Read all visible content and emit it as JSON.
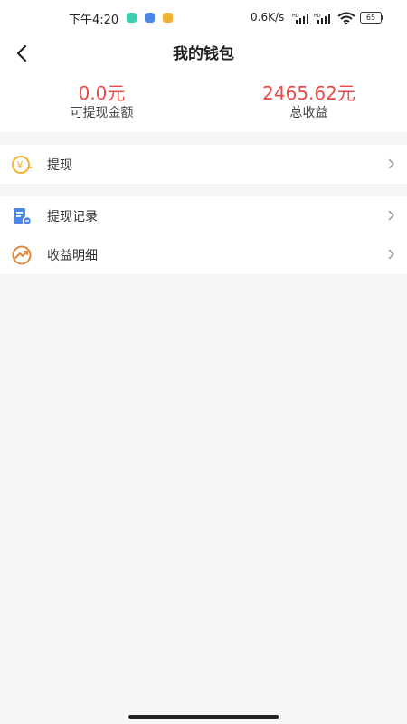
{
  "status_bar": {
    "time": "下午4:20",
    "network_speed": "0.6K/s",
    "battery": "65",
    "icons": [
      "app-notification-icon",
      "app-notification-icon",
      "app-notification-icon",
      "signal-hd-icon",
      "signal-hd-icon",
      "wifi-icon",
      "battery-icon"
    ]
  },
  "header": {
    "back_icon": "back-arrow-icon",
    "title": "我的钱包"
  },
  "summary": {
    "withdrawable_amount": "0.0元",
    "withdrawable_label": "可提现金额",
    "total_income_amount": "2465.62元",
    "total_income_label": "总收益",
    "accent_color": "#e94b4b"
  },
  "menu": {
    "withdraw": {
      "label": "提现",
      "icon": "yuan-coin-icon"
    },
    "records": [
      {
        "label": "提现记录",
        "icon": "document-record-icon"
      },
      {
        "label": "收益明细",
        "icon": "trend-up-icon"
      }
    ],
    "chevron_icon": "chevron-right-icon"
  }
}
